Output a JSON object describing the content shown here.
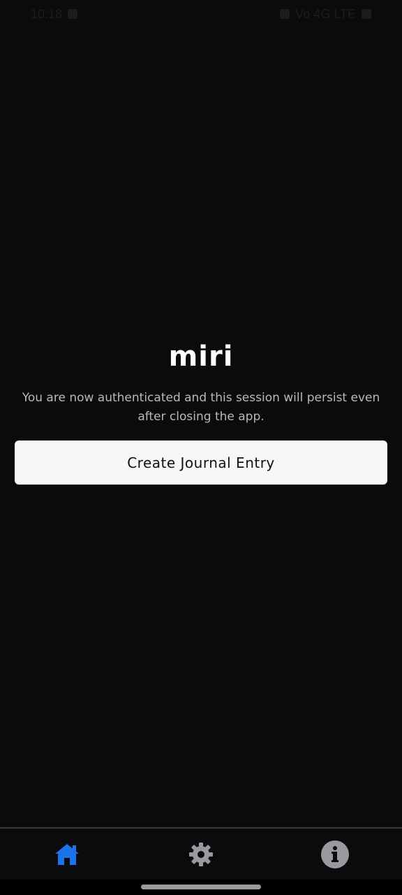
{
  "status_bar": {
    "time": "10:18",
    "indicators": "Vo 4G LTE"
  },
  "main": {
    "app_title": "miri",
    "auth_message": "You are now authenticated and this session will persist even after closing the app.",
    "create_entry_label": "Create Journal Entry"
  },
  "bottom_nav": {
    "items": [
      {
        "icon": "home-icon",
        "active": true,
        "color": "#1a73e8"
      },
      {
        "icon": "gear-icon",
        "active": false,
        "color": "#9a9a9e"
      },
      {
        "icon": "info-icon",
        "active": false,
        "color": "#9a9a9e"
      }
    ]
  },
  "colors": {
    "background": "#0b0b0d",
    "accent": "#1a73e8",
    "button_bg": "#f7f7f7"
  }
}
